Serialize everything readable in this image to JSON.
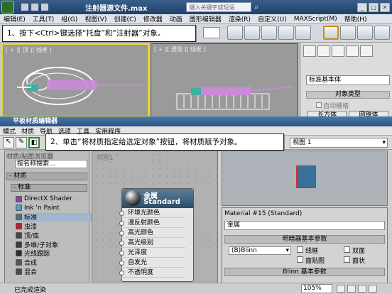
{
  "max_window": {
    "file_title": "注射器源文件.max",
    "search_placeholder": "键入关键字或短语",
    "menu": [
      "编辑(E)",
      "工具(T)",
      "组(G)",
      "视图(V)",
      "创建(C)",
      "修改器",
      "动画",
      "图形编辑器",
      "渲染(R)",
      "自定义(U)",
      "MAXScript(M)",
      "帮助(H)"
    ],
    "viewport_left_label": "[ + ][ 顶 ][ 线框 ]",
    "viewport_right_label": "[ + ][ 透视 ][ 线框 ]",
    "command_panel": {
      "dropdown": "标准基本体",
      "rollout_title": "对象类型",
      "autogrid": "自动栅格",
      "btn1": "长方体",
      "btn2": "圆锥体"
    }
  },
  "callouts": {
    "step1": "1、按下<Ctrl>键选择“托盘”和“注射器”对象。",
    "step2": "2、单击“将材质指定给选定对象”按钮，将材质赋予对象。"
  },
  "material_editor": {
    "title": "平板材质编辑器",
    "menu": [
      "模式",
      "材质",
      "导航",
      "选项",
      "工具",
      "实用程序"
    ],
    "view_label": "视图 1",
    "browser_header": "材质/贴图浏览器",
    "search_text": "按名称搜索...",
    "group_label": "- 材质",
    "subgroup_label": "- 标准",
    "materials": [
      {
        "name": "DirectX Shader",
        "color": "#7a4aa6"
      },
      {
        "name": "Ink 'n Paint",
        "color": "#3fa6d6"
      },
      {
        "name": "标准",
        "color": "#6b6b6b"
      },
      {
        "name": "虫漆",
        "color": "#b0203a"
      },
      {
        "name": "顶/底",
        "color": "#444444"
      },
      {
        "name": "多维/子对象",
        "color": "#3a3a3a"
      },
      {
        "name": "光线跟踪",
        "color": "#2e2e2e"
      },
      {
        "name": "合成",
        "color": "#555555"
      },
      {
        "name": "混合",
        "color": "#4a4a4a"
      }
    ],
    "graph_label": "视图1",
    "node": {
      "name": "金属",
      "type": "Standard",
      "slots": [
        "环境光颜色",
        "漫反射颜色",
        "高光颜色",
        "高光级别",
        "光泽度",
        "自发光",
        "不透明度"
      ]
    },
    "param_title": "Material #15 (Standard)",
    "material_name": "金属",
    "basic_params_title": "明暗器基本参数",
    "shader": "(B)Blinn",
    "options": [
      "线框",
      "双面",
      "面贴图",
      "面状"
    ],
    "blinn_title": "Blinn 基本参数",
    "status_text": "已完成渲染",
    "zoom": "105%"
  }
}
